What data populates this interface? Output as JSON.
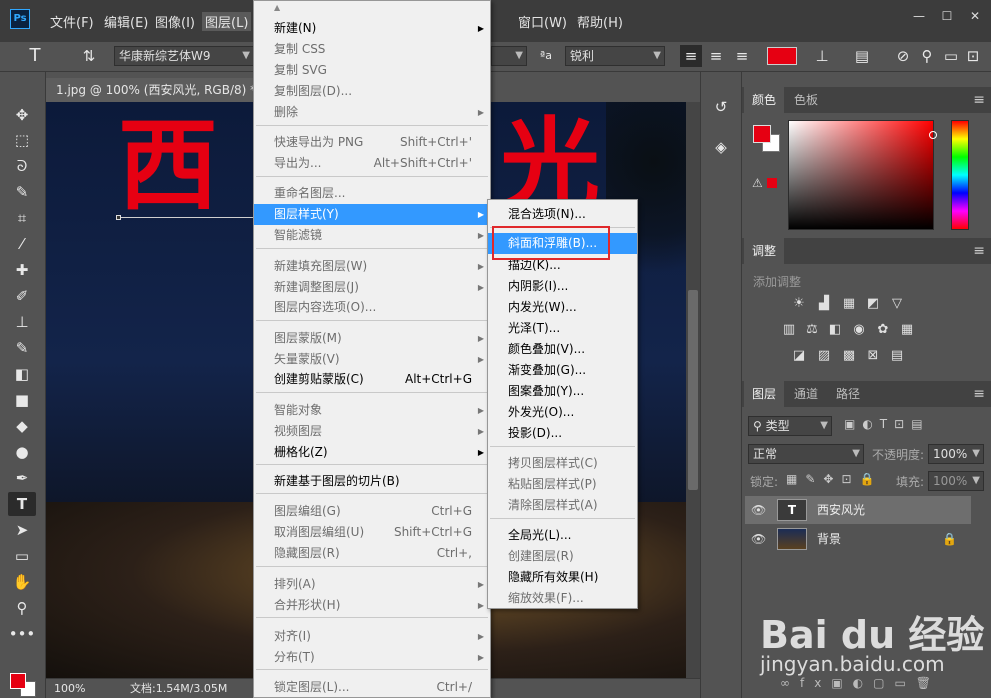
{
  "app": {
    "logo": "Ps"
  },
  "menubar": {
    "items": [
      "文件(F)",
      "编辑(E)",
      "图像(I)",
      "图层(L)",
      "窗口(W)",
      "帮助(H)"
    ],
    "window_buttons": [
      "—",
      "☐",
      "✕"
    ]
  },
  "options": {
    "font_family": "华康新综艺体W9",
    "antialias_icon": "ªa",
    "antialias": "锐利",
    "text_color": "#e60012"
  },
  "document": {
    "tab_title": "1.jpg @ 100% (西安风光, RGB/8) *",
    "canvas_text_1": "西",
    "canvas_text_2": "光",
    "zoom": "100%",
    "doc_size": "文档:1.54M/3.05M"
  },
  "layer_menu": {
    "items": [
      {
        "label": "新建(N)",
        "enabled": true,
        "submenu": true
      },
      {
        "label": "复制 CSS",
        "enabled": false
      },
      {
        "label": "复制 SVG",
        "enabled": false
      },
      {
        "label": "复制图层(D)...",
        "enabled": false
      },
      {
        "label": "删除",
        "enabled": false,
        "submenu": true
      },
      {
        "label": "快速导出为 PNG",
        "enabled": false,
        "shortcut": "Shift+Ctrl+'"
      },
      {
        "label": "导出为...",
        "enabled": false,
        "shortcut": "Alt+Shift+Ctrl+'"
      },
      {
        "label": "重命名图层...",
        "enabled": false
      },
      {
        "label": "图层样式(Y)",
        "enabled": true,
        "submenu": true,
        "highlighted": true
      },
      {
        "label": "智能滤镜",
        "enabled": false,
        "submenu": true
      },
      {
        "label": "新建填充图层(W)",
        "enabled": false,
        "submenu": true
      },
      {
        "label": "新建调整图层(J)",
        "enabled": false,
        "submenu": true
      },
      {
        "label": "图层内容选项(O)...",
        "enabled": false
      },
      {
        "label": "图层蒙版(M)",
        "enabled": false,
        "submenu": true
      },
      {
        "label": "矢量蒙版(V)",
        "enabled": false,
        "submenu": true
      },
      {
        "label": "创建剪贴蒙版(C)",
        "enabled": true,
        "shortcut": "Alt+Ctrl+G"
      },
      {
        "label": "智能对象",
        "enabled": false,
        "submenu": true
      },
      {
        "label": "视频图层",
        "enabled": false,
        "submenu": true
      },
      {
        "label": "栅格化(Z)",
        "enabled": true,
        "submenu": true
      },
      {
        "label": "新建基于图层的切片(B)",
        "enabled": true
      },
      {
        "label": "图层编组(G)",
        "enabled": false,
        "shortcut": "Ctrl+G"
      },
      {
        "label": "取消图层编组(U)",
        "enabled": false,
        "shortcut": "Shift+Ctrl+G"
      },
      {
        "label": "隐藏图层(R)",
        "enabled": false,
        "shortcut": "Ctrl+,"
      },
      {
        "label": "排列(A)",
        "enabled": false,
        "submenu": true
      },
      {
        "label": "合并形状(H)",
        "enabled": false,
        "submenu": true
      },
      {
        "label": "对齐(I)",
        "enabled": false,
        "submenu": true
      },
      {
        "label": "分布(T)",
        "enabled": false,
        "submenu": true
      },
      {
        "label": "锁定图层(L)...",
        "enabled": false,
        "shortcut": "Ctrl+/"
      }
    ]
  },
  "style_menu": {
    "items": [
      {
        "label": "混合选项(N)...",
        "enabled": true
      },
      {
        "label": "斜面和浮雕(B)...",
        "enabled": true,
        "highlighted": true
      },
      {
        "label": "描边(K)...",
        "enabled": true
      },
      {
        "label": "内阴影(I)...",
        "enabled": true
      },
      {
        "label": "内发光(W)...",
        "enabled": true
      },
      {
        "label": "光泽(T)...",
        "enabled": true
      },
      {
        "label": "颜色叠加(V)...",
        "enabled": true
      },
      {
        "label": "渐变叠加(G)...",
        "enabled": true
      },
      {
        "label": "图案叠加(Y)...",
        "enabled": true
      },
      {
        "label": "外发光(O)...",
        "enabled": true
      },
      {
        "label": "投影(D)...",
        "enabled": true
      },
      {
        "label": "拷贝图层样式(C)",
        "enabled": false
      },
      {
        "label": "粘贴图层样式(P)",
        "enabled": false
      },
      {
        "label": "清除图层样式(A)",
        "enabled": false
      },
      {
        "label": "全局光(L)...",
        "enabled": true
      },
      {
        "label": "创建图层(R)",
        "enabled": false
      },
      {
        "label": "隐藏所有效果(H)",
        "enabled": true
      },
      {
        "label": "缩放效果(F)...",
        "enabled": false
      }
    ]
  },
  "panels": {
    "color_tabs": [
      "颜色",
      "色板"
    ],
    "adjust_tab": "调整",
    "adjust_hint": "添加调整",
    "layers_tabs": [
      "图层",
      "通道",
      "路径"
    ],
    "kind_label": "类型",
    "blend_mode": "正常",
    "opacity_label": "不透明度:",
    "opacity_value": "100%",
    "lock_label": "锁定:",
    "fill_label": "填充:",
    "fill_value": "100%",
    "layers": [
      {
        "name": "西安风光",
        "type": "text",
        "thumb": "T",
        "selected": true
      },
      {
        "name": "背景",
        "type": "image",
        "locked": true
      }
    ],
    "fg_color": "#e60012",
    "bg_color": "#ffffff"
  },
  "watermark": {
    "brand": "Bai du 经验",
    "url": "jingyan.baidu.com"
  }
}
